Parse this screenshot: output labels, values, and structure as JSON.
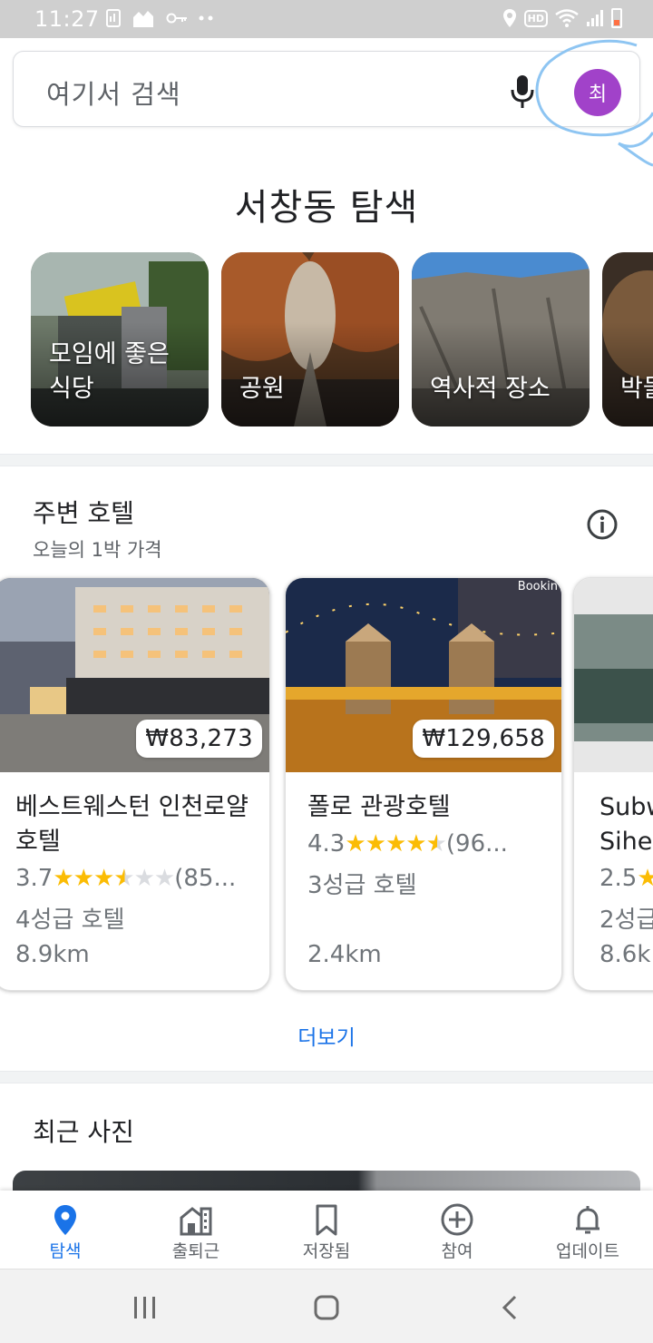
{
  "status_bar": {
    "time": "11:27",
    "hd": "HD",
    "icons": [
      "gallery-icon",
      "home-person-icon",
      "key-icon",
      "more-dots-icon",
      "location-icon",
      "hd-icon",
      "wifi-icon",
      "signal-icon",
      "battery-icon"
    ]
  },
  "search": {
    "placeholder": "여기서 검색",
    "avatar_initial": "최",
    "avatar_color": "#a142c9"
  },
  "explore": {
    "title": "서창동 탐색",
    "categories": [
      {
        "label": "모임에 좋은 식당"
      },
      {
        "label": "공원"
      },
      {
        "label": "역사적 장소"
      },
      {
        "label": "박물"
      }
    ]
  },
  "hotels": {
    "title": "주변 호텔",
    "subtitle": "오늘의 1박 가격",
    "items": [
      {
        "price": "₩83,273",
        "name": "베스트웨스턴 인천로얄호텔",
        "rating": "3.7",
        "stars": "★★★",
        "half": "★",
        "empty_stars": "★",
        "reviews": "(85...",
        "rating_out_of_5": 3.7,
        "class": "4성급 호텔",
        "distance": "8.9km"
      },
      {
        "price": "₩129,658",
        "name": "폴로 관광호텔",
        "rating": "4.3",
        "stars": "★★★★",
        "half": "★",
        "empty_stars": "",
        "reviews": "(96...",
        "rating_out_of_5": 4.3,
        "class": "3성급 호텔",
        "distance": "2.4km",
        "photo_watermark": "Bookin"
      },
      {
        "name": "Subw Sihe",
        "rating": "2.5",
        "stars": "★",
        "class": "2성급",
        "distance": "8.6k"
      }
    ],
    "more": "더보기"
  },
  "recent": {
    "title": "최근 사진"
  },
  "bottom_nav": {
    "items": [
      {
        "label": "탐색",
        "icon": "explore-pin-icon",
        "active": true
      },
      {
        "label": "출퇴근",
        "icon": "commute-icon",
        "active": false
      },
      {
        "label": "저장됨",
        "icon": "bookmark-icon",
        "active": false
      },
      {
        "label": "참여",
        "icon": "add-circle-icon",
        "active": false
      },
      {
        "label": "업데이트",
        "icon": "bell-icon",
        "active": false
      }
    ]
  },
  "colors": {
    "accent": "#1a73e8",
    "star": "#fbbc04",
    "scribble": "#8ec5f2"
  }
}
